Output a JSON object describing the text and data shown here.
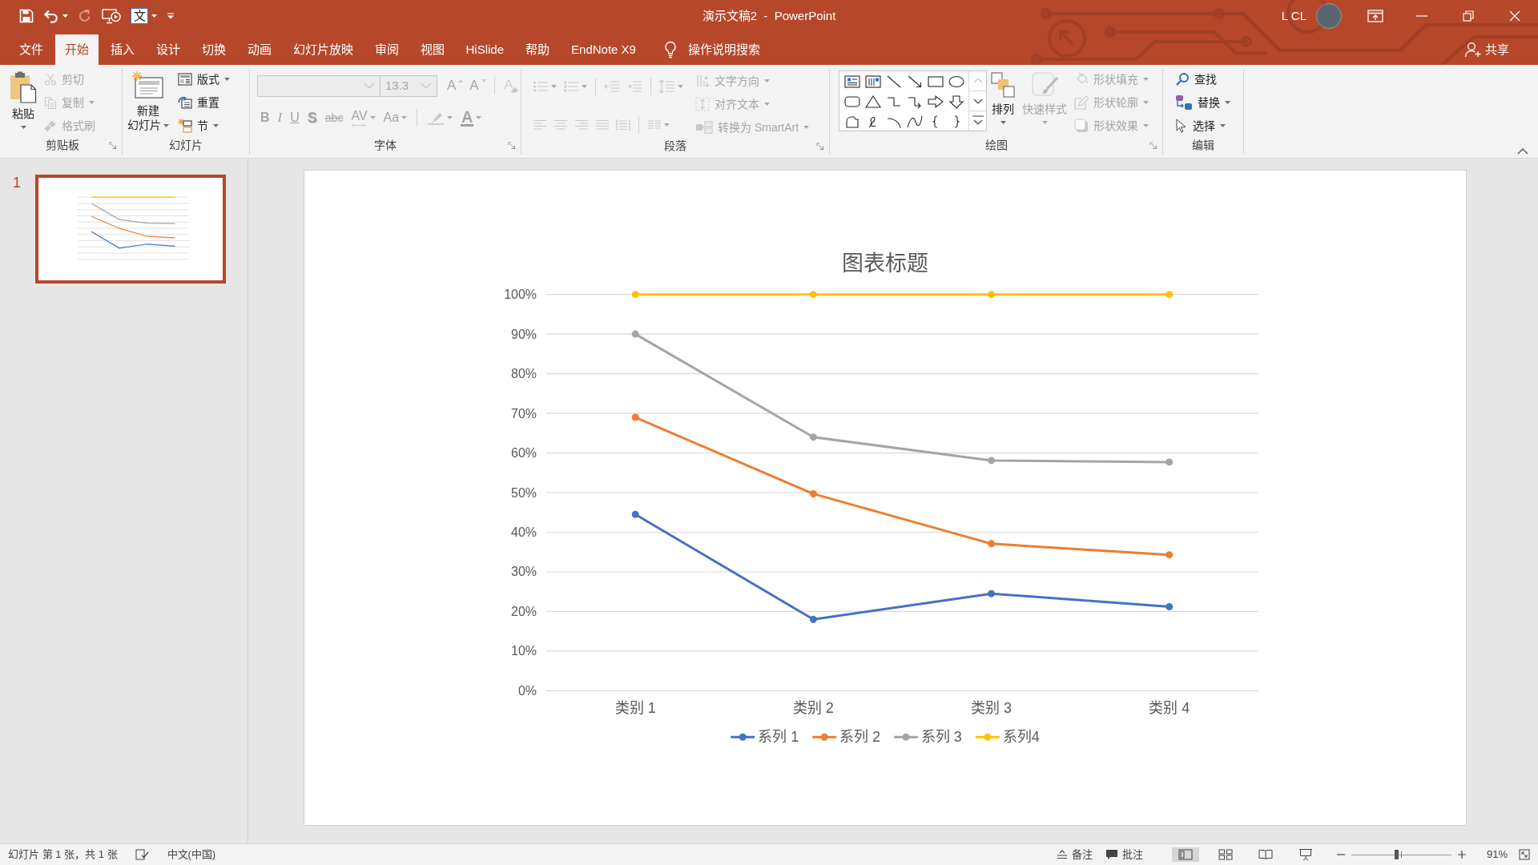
{
  "window": {
    "title": "演示文稿2  -  PowerPoint",
    "user": "L CL"
  },
  "quick_access": [
    {
      "disabled": false,
      "dropdown": false
    },
    {
      "disabled": false,
      "dropdown": true
    },
    {
      "disabled": true,
      "dropdown": false
    },
    {
      "disabled": false,
      "dropdown": false
    },
    {
      "label": "文",
      "disabled": false,
      "dropdown": true
    },
    {
      "disabled": false,
      "dropdown": false
    }
  ],
  "tabs": [
    {
      "label": "文件",
      "selected": false
    },
    {
      "label": "开始",
      "selected": true
    },
    {
      "label": "插入",
      "selected": false
    },
    {
      "label": "设计",
      "selected": false
    },
    {
      "label": "切换",
      "selected": false
    },
    {
      "label": "动画",
      "selected": false
    },
    {
      "label": "幻灯片放映",
      "selected": false
    },
    {
      "label": "审阅",
      "selected": false
    },
    {
      "label": "视图",
      "selected": false
    },
    {
      "label": "HiSlide",
      "selected": false
    },
    {
      "label": "帮助",
      "selected": false
    },
    {
      "label": "EndNote X9",
      "selected": false
    }
  ],
  "tell_me": {
    "label": "操作说明搜索"
  },
  "share": {
    "label": "共享"
  },
  "ribbon": {
    "groups": [
      {
        "label": "剪贴板",
        "launcher": true,
        "items": [
          {
            "label": "粘贴",
            "dropdown": true,
            "disabled": false
          },
          {
            "label": "剪切",
            "dropdown": false,
            "disabled": true
          },
          {
            "label": "复制",
            "dropdown": true,
            "disabled": true
          },
          {
            "label": "格式刷",
            "dropdown": false,
            "disabled": true
          }
        ]
      },
      {
        "label": "幻灯片",
        "launcher": false,
        "items": [
          {
            "label_lines": [
              "新建",
              "幻灯片"
            ],
            "dropdown": true,
            "disabled": false
          },
          {
            "label": "版式",
            "dropdown": true,
            "disabled": false
          },
          {
            "label": "重置",
            "dropdown": false,
            "disabled": false
          },
          {
            "label": "节",
            "dropdown": true,
            "disabled": false
          }
        ]
      },
      {
        "label": "字体",
        "launcher": true,
        "font_name": {
          "disabled": true
        },
        "font_size": {
          "value": "13.3",
          "disabled": true
        },
        "items": [
          {
            "kind": "grow",
            "label": "A",
            "dropdown": false,
            "disabled": true
          },
          {
            "kind": "shrink",
            "label": "A",
            "dropdown": false,
            "disabled": true
          },
          {
            "kind": "clear",
            "dropdown": false,
            "disabled": true
          },
          {
            "kind": "bold",
            "label": "B",
            "dropdown": false,
            "disabled": true
          },
          {
            "kind": "italic",
            "label": "I",
            "dropdown": false,
            "disabled": true
          },
          {
            "kind": "underline",
            "label": "U",
            "dropdown": false,
            "disabled": true
          },
          {
            "kind": "shadow",
            "label": "S",
            "dropdown": false,
            "disabled": true
          },
          {
            "kind": "strike",
            "label": "abc",
            "dropdown": false,
            "disabled": true
          },
          {
            "kind": "spacing",
            "label": "AV",
            "dropdown": true,
            "disabled": true
          },
          {
            "kind": "case",
            "label": "Aa",
            "dropdown": true,
            "disabled": true
          },
          {
            "kind": "highlight",
            "dropdown": true,
            "disabled": true
          },
          {
            "kind": "color",
            "label": "A",
            "dropdown": true,
            "disabled": true
          }
        ]
      },
      {
        "label": "段落",
        "launcher": true,
        "items": [
          {
            "kind": "bullets",
            "dropdown": true,
            "disabled": true
          },
          {
            "kind": "numbering",
            "dropdown": true,
            "disabled": true
          },
          {
            "kind": "outdent",
            "dropdown": false,
            "disabled": true
          },
          {
            "kind": "indent",
            "dropdown": false,
            "disabled": true
          },
          {
            "kind": "line_spacing",
            "dropdown": true,
            "disabled": true
          },
          {
            "kind": "direction",
            "label": "文字方向",
            "dropdown": true,
            "disabled": true
          },
          {
            "kind": "valign",
            "label": "对齐文本",
            "dropdown": true,
            "disabled": true
          },
          {
            "kind": "smartart",
            "label": "转换为 SmartArt",
            "dropdown": true,
            "disabled": true
          },
          {
            "kind": "left",
            "dropdown": false,
            "disabled": true
          },
          {
            "kind": "center",
            "dropdown": false,
            "disabled": true
          },
          {
            "kind": "right",
            "dropdown": false,
            "disabled": true
          },
          {
            "kind": "justify",
            "dropdown": false,
            "disabled": true
          },
          {
            "kind": "distribute",
            "dropdown": false,
            "disabled": true
          },
          {
            "kind": "columns",
            "dropdown": true,
            "disabled": true
          }
        ]
      },
      {
        "label": "绘图",
        "launcher": true,
        "gallery": {
          "scroll": [
            {
              "disabled": true
            },
            {
              "disabled": false
            },
            {
              "disabled": false
            }
          ]
        },
        "items": [
          {
            "label": "排列",
            "dropdown": true,
            "disabled": false
          },
          {
            "label": "快速样式",
            "dropdown": true,
            "disabled": true
          },
          {
            "label": "形状填充",
            "dropdown": true,
            "disabled": true
          },
          {
            "label": "形状轮廓",
            "dropdown": true,
            "disabled": true
          },
          {
            "label": "形状效果",
            "dropdown": true,
            "disabled": true
          }
        ]
      },
      {
        "label": "编辑",
        "launcher": false,
        "items": [
          {
            "label": "查找",
            "dropdown": false,
            "disabled": false
          },
          {
            "label": "替换",
            "dropdown": true,
            "disabled": false
          },
          {
            "label": "选择",
            "dropdown": true,
            "disabled": false
          }
        ]
      }
    ]
  },
  "slides": [
    {
      "number": "1",
      "selected": true
    }
  ],
  "slide": {
    "chart_data": {
      "type": "line",
      "title": "图表标题",
      "categories": [
        "类别 1",
        "类别 2",
        "类别 3",
        "类别 4"
      ],
      "series": [
        {
          "name": "系列 1",
          "color": "#4472c4",
          "marker": "circle",
          "values": [
            44.5,
            18,
            24.5,
            21.2
          ]
        },
        {
          "name": "系列 2",
          "color": "#ed7d31",
          "marker": "circle",
          "values": [
            69,
            49.7,
            37.1,
            34.3
          ]
        },
        {
          "name": "系列 3",
          "color": "#a5a5a5",
          "marker": "circle",
          "values": [
            90,
            64,
            58.1,
            57.7
          ]
        },
        {
          "name": "系列4",
          "color": "#ffc000",
          "marker": "circle",
          "values": [
            100,
            100,
            100,
            100
          ]
        }
      ],
      "ylim": [
        0,
        100
      ],
      "yticks": [
        {
          "value": 0,
          "label": "0%"
        },
        {
          "value": 10,
          "label": "10%"
        },
        {
          "value": 20,
          "label": "20%"
        },
        {
          "value": 30,
          "label": "30%"
        },
        {
          "value": 40,
          "label": "40%"
        },
        {
          "value": 50,
          "label": "50%"
        },
        {
          "value": 60,
          "label": "60%"
        },
        {
          "value": 70,
          "label": "70%"
        },
        {
          "value": 80,
          "label": "80%"
        },
        {
          "value": 90,
          "label": "90%"
        },
        {
          "value": 100,
          "label": "100%"
        }
      ],
      "grid": true,
      "legend": "bottom"
    }
  },
  "status_bar": {
    "slide_info": "幻灯片 第 1 张，共 1 张",
    "language": "中文(中国)",
    "notes": "备注",
    "comments": "批注",
    "views": [
      {
        "selected": true
      },
      {
        "selected": false
      },
      {
        "selected": false
      },
      {
        "selected": false
      }
    ],
    "zoom": {
      "level": 0.45,
      "reading": "91%"
    }
  }
}
